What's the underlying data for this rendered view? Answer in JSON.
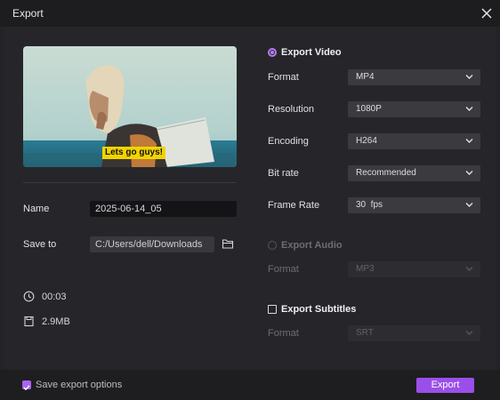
{
  "window": {
    "title": "Export"
  },
  "preview": {
    "caption": "Lets go guys!"
  },
  "left": {
    "name_label": "Name",
    "name_value": "2025-06-14_05",
    "save_label": "Save to",
    "save_value": "C:/Users/dell/Downloads",
    "duration": "00:03",
    "size": "2.9MB"
  },
  "video": {
    "section_label": "Export Video",
    "format_label": "Format",
    "format_value": "MP4",
    "resolution_label": "Resolution",
    "resolution_value": "1080P",
    "encoding_label": "Encoding",
    "encoding_value": "H264",
    "bitrate_label": "Bit rate",
    "bitrate_value": "Recommended",
    "framerate_label": "Frame Rate",
    "framerate_value": "30  fps"
  },
  "audio": {
    "section_label": "Export Audio",
    "format_label": "Format",
    "format_value": "MP3"
  },
  "subtitles": {
    "section_label": "Export Subtitles",
    "format_label": "Format",
    "format_value": "SRT"
  },
  "footer": {
    "save_options_label": "Save export options",
    "export_label": "Export"
  },
  "colors": {
    "accent": "#9b4fe9",
    "accent_light": "#b67cf0"
  },
  "icons": [
    "close-icon",
    "folder-icon",
    "clock-icon",
    "file-icon",
    "chevron-down-icon"
  ]
}
